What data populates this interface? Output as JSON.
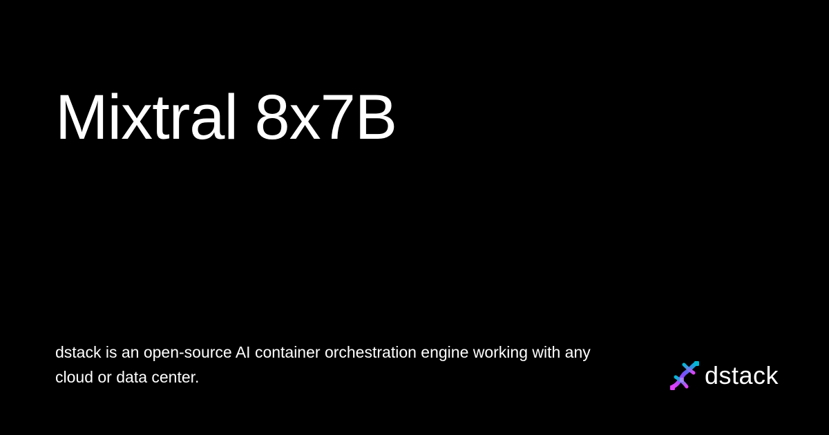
{
  "title": "Mixtral 8x7B",
  "description": "dstack is an open-source AI container orchestration engine working with any cloud or data center.",
  "brand": {
    "name": "dstack",
    "icon": "dstack-logo-icon",
    "gradient": [
      "#e040fb",
      "#7c4dff",
      "#00b8d4"
    ]
  },
  "colors": {
    "background": "#000000",
    "text": "#ffffff"
  }
}
